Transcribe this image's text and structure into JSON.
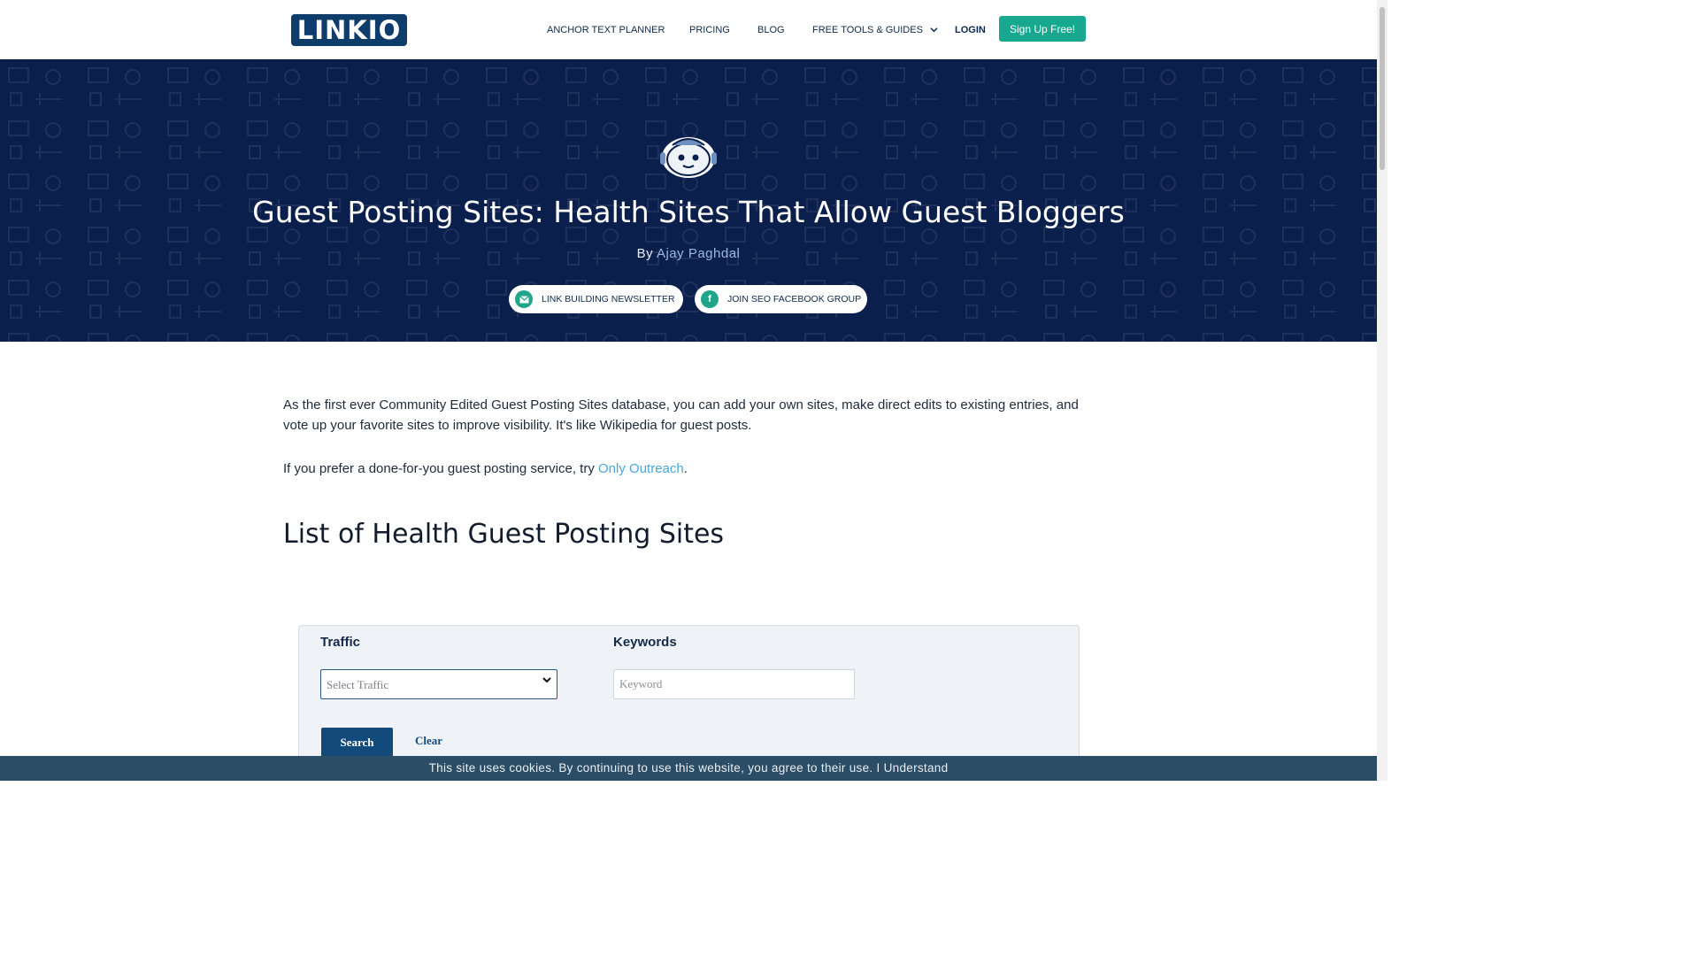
{
  "header": {
    "logo_text": "LINKIO",
    "nav": [
      "ANCHOR TEXT PLANNER",
      "PRICING",
      "BLOG",
      "FREE TOOLS & GUIDES"
    ],
    "login": "LOGIN",
    "signup": "Sign Up Free!"
  },
  "hero": {
    "title": "Guest Posting Sites: Health Sites That Allow Guest Bloggers",
    "by": "By",
    "author": "Ajay Paghdal",
    "newsletter": "LINK BUILDING NEWSLETTER",
    "facebook": "JOIN SEO FACEBOOK GROUP"
  },
  "content": {
    "intro": "As the first ever Community Edited Guest Posting Sites database, you can add your own sites, make direct edits to existing entries, and vote up your favorite sites to improve visibility. It's like Wikipedia for guest posts.",
    "prefer_text": "If you prefer a done-for-you guest posting service, try ",
    "prefer_link": "Only Outreach",
    "prefer_end": ".",
    "list_heading": "List of Health Guest Posting Sites"
  },
  "filter": {
    "traffic_label": "Traffic",
    "traffic_placeholder": "Select Traffic",
    "keywords_label": "Keywords",
    "keyword_placeholder": "Keyword",
    "search": "Search",
    "clear": "Clear"
  },
  "cookie": "This site uses cookies. By continuing to use this website, you agree to their use. I Understand",
  "icons": {
    "mascot": "robot-mascot-icon",
    "email": "envelope-icon",
    "facebook": "facebook-icon",
    "dropdown": "chevron-down-icon"
  },
  "colors": {
    "hero_bg": "#0b1f4d",
    "accent_green": "#17a88f",
    "button_blue": "#134a7c",
    "link": "#4aa8d8"
  }
}
